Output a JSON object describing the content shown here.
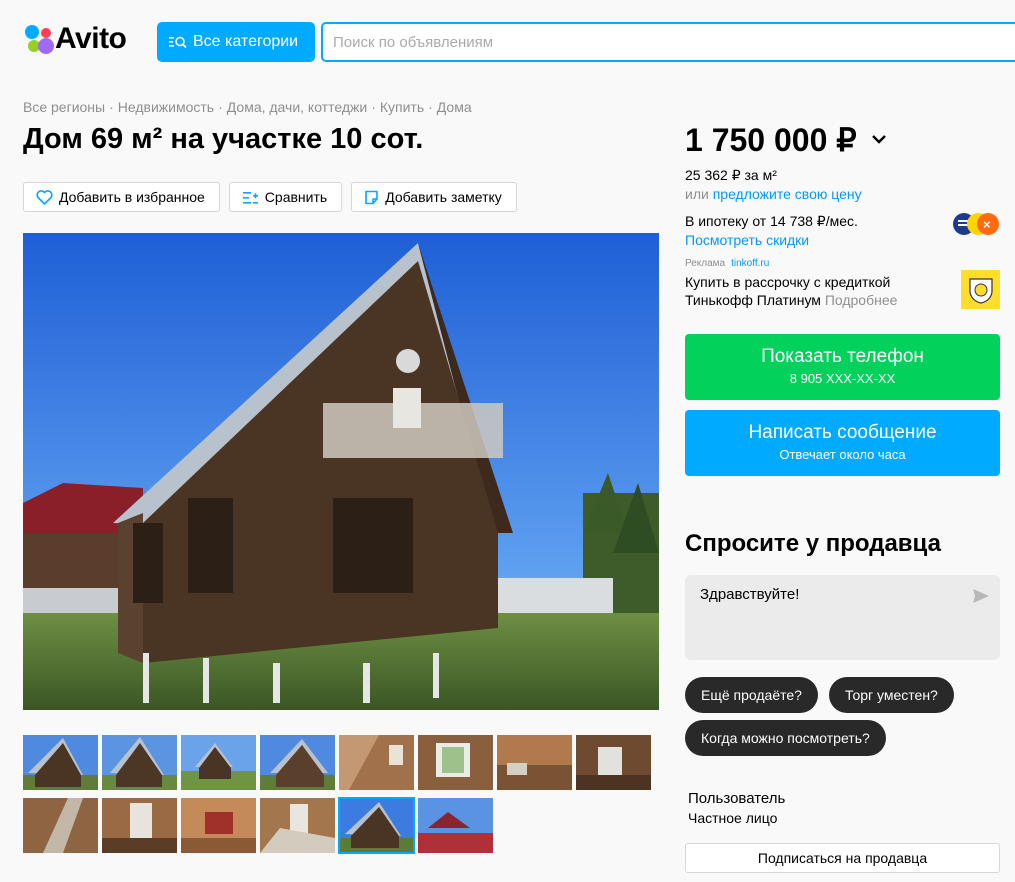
{
  "header": {
    "logo_text": "Avito",
    "categories_button": "Все категории",
    "search_placeholder": "Поиск по объявлениям"
  },
  "breadcrumbs": [
    "Все регионы",
    "Недвижимость",
    "Дома, дачи, коттеджи",
    "Купить",
    "Дома"
  ],
  "listing": {
    "title": "Дом 69 м² на участке 10 сот.",
    "actions": {
      "favorite": "Добавить в избранное",
      "compare": "Сравнить",
      "note": "Добавить заметку"
    },
    "thumbnail_count": 13,
    "selected_thumbnail": 11
  },
  "price": {
    "value": "1 750 000 ₽",
    "per_meter": "25 362 ₽ за м²",
    "offer_prefix": "или",
    "offer_link": "предложите свою цену",
    "mortgage": "В ипотеку от 14 738 ₽/мес.",
    "discounts_link": "Посмотреть скидки"
  },
  "ad": {
    "label": "Реклама",
    "domain": "tinkoff.ru",
    "text": "Купить в рассрочку с кредиткой Тинькофф Платинум",
    "more": "Подробнее"
  },
  "contact": {
    "phone_button": "Показать телефон",
    "phone_number": "8 905 XXX-XX-XX",
    "message_button": "Написать сообщение",
    "message_sub": "Отвечает около часа"
  },
  "ask": {
    "title": "Спросите у продавца",
    "message": "Здравствуйте!",
    "chips": [
      "Ещё продаёте?",
      "Торг уместен?",
      "Когда можно посмотреть?"
    ]
  },
  "seller": {
    "name": "Пользователь",
    "type": "Частное лицо",
    "subscribe_button": "Подписаться на продавца"
  },
  "colors": {
    "accent": "#00aaff",
    "phone_green": "#02d15c",
    "link": "#0099f7",
    "chip_dark": "#292929"
  }
}
